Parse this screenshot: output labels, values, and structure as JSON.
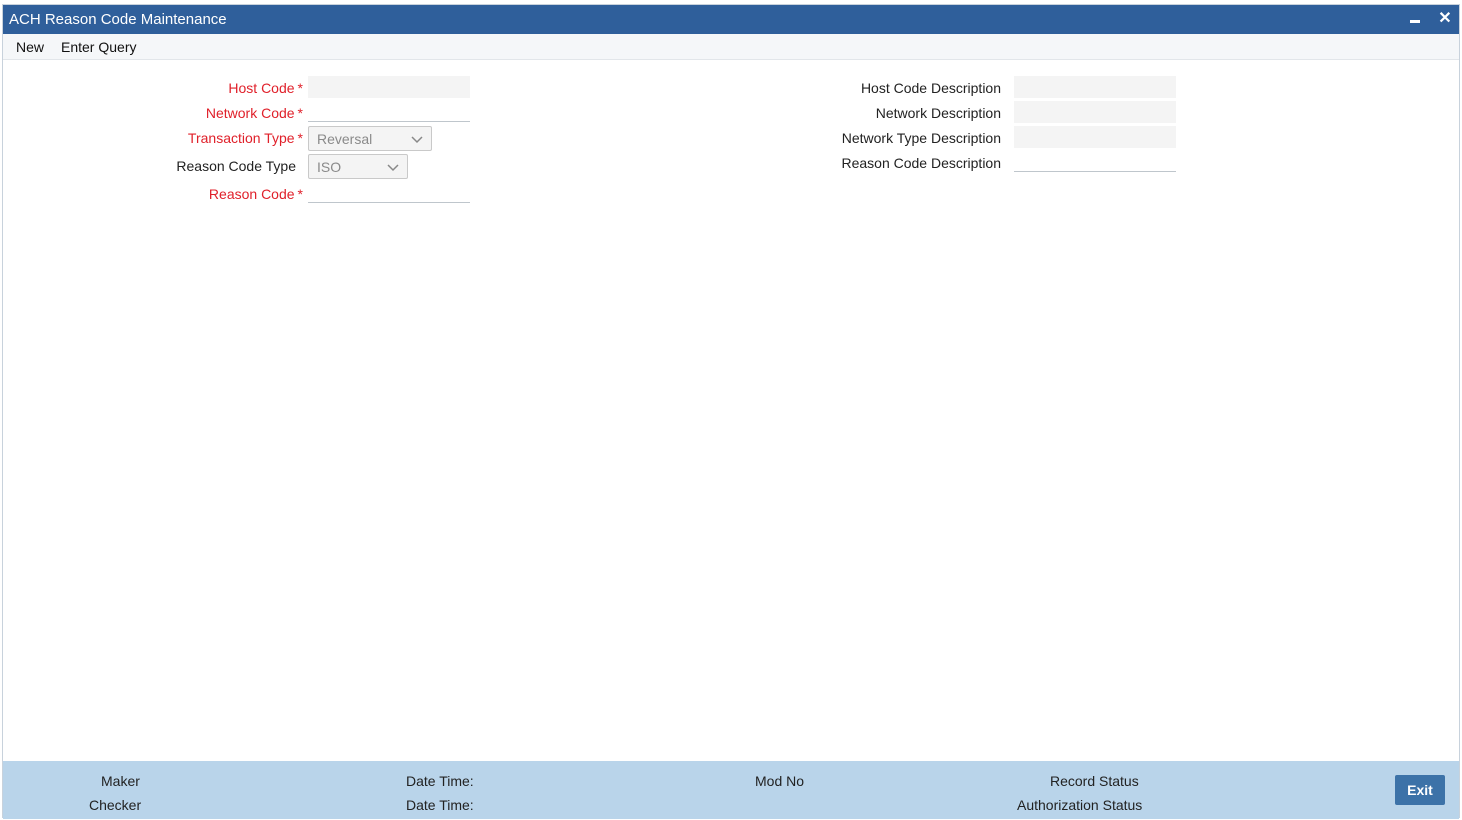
{
  "window": {
    "title": "ACH Reason Code Maintenance"
  },
  "menu": {
    "new_label": "New",
    "enter_query_label": "Enter Query"
  },
  "form": {
    "host_code": {
      "label": "Host Code",
      "value": ""
    },
    "network_code": {
      "label": "Network Code",
      "value": ""
    },
    "transaction_type": {
      "label": "Transaction Type",
      "selected": "Reversal"
    },
    "reason_code_type": {
      "label": "Reason Code Type",
      "selected": "ISO"
    },
    "reason_code": {
      "label": "Reason Code",
      "value": ""
    },
    "host_code_description": {
      "label": "Host Code Description",
      "value": ""
    },
    "network_description": {
      "label": "Network Description",
      "value": ""
    },
    "network_type_description": {
      "label": "Network Type Description",
      "value": ""
    },
    "reason_code_description": {
      "label": "Reason Code Description",
      "value": ""
    },
    "required_marker": "*"
  },
  "footer": {
    "maker_label": "Maker",
    "checker_label": "Checker",
    "date_time_label": "Date Time:",
    "mod_no_label": "Mod No",
    "record_status_label": "Record Status",
    "authorization_status_label": "Authorization Status",
    "exit_label": "Exit"
  },
  "colors": {
    "title_bar": "#2f5f9b",
    "required": "#e0202a",
    "footer": "#b9d4ea",
    "exit_button": "#3c72a8"
  }
}
